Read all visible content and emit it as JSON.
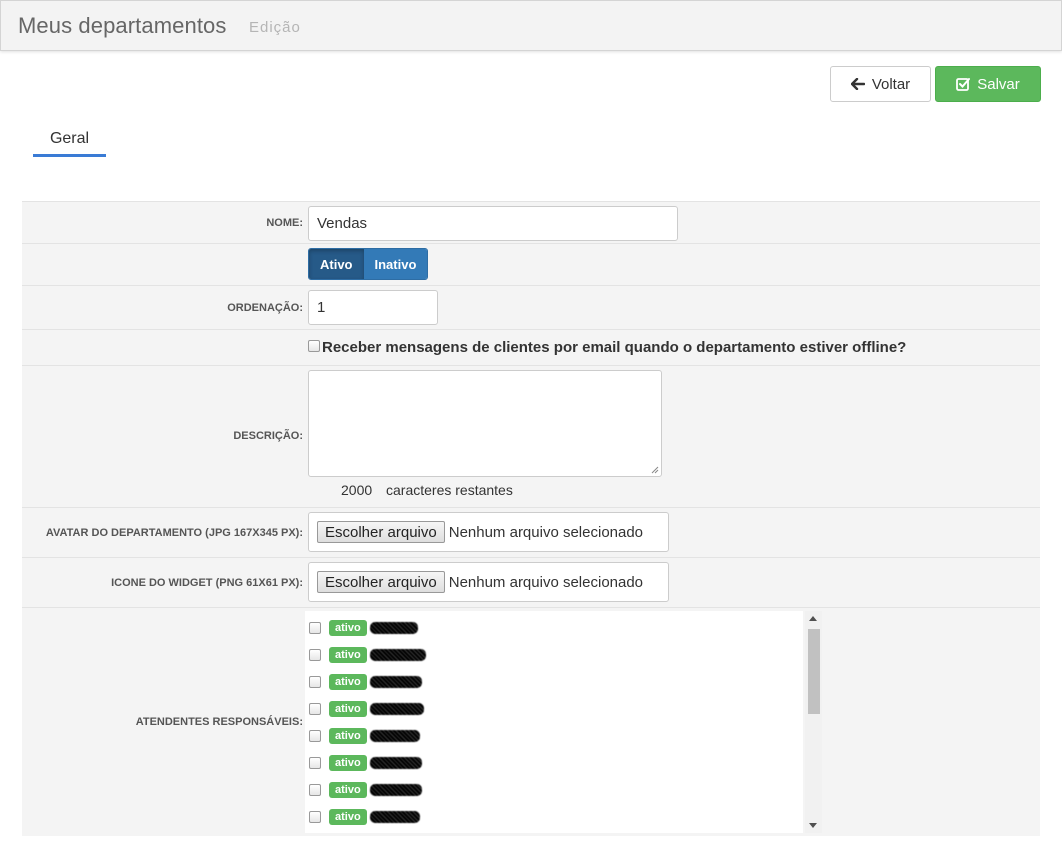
{
  "header": {
    "title": "Meus departamentos",
    "subtitle": "Edição"
  },
  "actions": {
    "back_label": "Voltar",
    "save_label": "Salvar"
  },
  "tabs": [
    {
      "label": "Geral",
      "active": true
    }
  ],
  "form": {
    "name": {
      "label": "NOME:",
      "value": "Vendas"
    },
    "status": {
      "options": [
        "Ativo",
        "Inativo"
      ],
      "selected": "Ativo"
    },
    "order": {
      "label": "ORDENAÇÃO:",
      "value": "1"
    },
    "offline_email": {
      "label": "Receber mensagens de clientes por email quando o departamento estiver offline?",
      "checked": false
    },
    "description": {
      "label": "DESCRIÇÃO:",
      "value": "",
      "remaining_count": "2000",
      "remaining_text": "caracteres restantes"
    },
    "avatar": {
      "label": "AVATAR DO DEPARTAMENTO (JPG 167X345 PX):",
      "button_label": "Escolher arquivo",
      "status": "Nenhum arquivo selecionado"
    },
    "widget_icon": {
      "label": "ICONE DO WIDGET (PNG 61X61 PX):",
      "button_label": "Escolher arquivo",
      "status": "Nenhum arquivo selecionado"
    },
    "attendants": {
      "label": "ATENDENTES RESPONSÁVEIS:",
      "items": [
        {
          "badge": "ativo",
          "checked": false
        },
        {
          "badge": "ativo",
          "checked": false
        },
        {
          "badge": "ativo",
          "checked": false
        },
        {
          "badge": "ativo",
          "checked": false
        },
        {
          "badge": "ativo",
          "checked": false
        },
        {
          "badge": "ativo",
          "checked": false
        },
        {
          "badge": "ativo",
          "checked": false
        },
        {
          "badge": "ativo",
          "checked": false
        }
      ]
    }
  },
  "colors": {
    "primary": "#337ab7",
    "primary_active": "#265a88",
    "success": "#5cb85c",
    "tab_underline": "#3a7bd5",
    "form_bg": "#f4f4f4"
  }
}
